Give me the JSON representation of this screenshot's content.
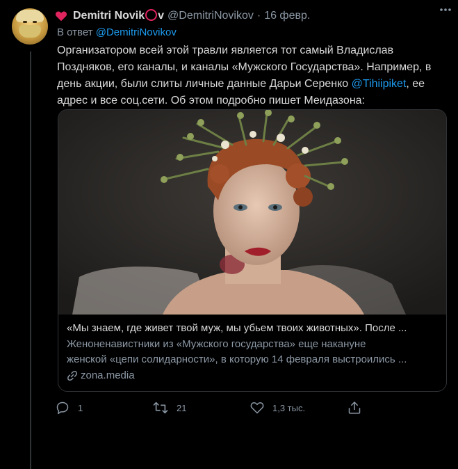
{
  "tweet": {
    "display_name_prefix": "Demitri Novik",
    "display_name_suffix": "v",
    "handle": "@DemitriNovikov",
    "separator": "·",
    "date": "16 февр.",
    "reply_prefix": "В ответ",
    "reply_to": "@DemitriNovikov",
    "text_before": "Организатором всей этой травли является тот самый Владислав Поздняков, его каналы, и каналы «Мужского Государства». Например, в день акции, были слиты личные данные Дарьи Серенко ",
    "text_mention": "@Tihiipiket",
    "text_after": ", ее адрес и все соц.сети. Об этом подробно пишет Меидазона:"
  },
  "card": {
    "title": "«Мы знаем, где живет твой муж, мы убьем твоих животных». После ...",
    "desc_line1": "Женоненавистники из «Мужского государства» еще накануне",
    "desc_line2": "женской «цепи солидарности», в которую 14 февраля выстроились ...",
    "domain": "zona.media"
  },
  "actions": {
    "reply_count": "1",
    "retweet_count": "21",
    "like_count": "1,3 тыс."
  },
  "icons": [
    "heart-icon",
    "more-icon",
    "link-icon",
    "reply-icon",
    "retweet-icon",
    "like-icon",
    "share-icon"
  ],
  "colors": {
    "background": "#000000",
    "text": "#d9d9d9",
    "muted": "#8b98a5",
    "link": "#1d9bf0",
    "heart": "#e0245e"
  }
}
